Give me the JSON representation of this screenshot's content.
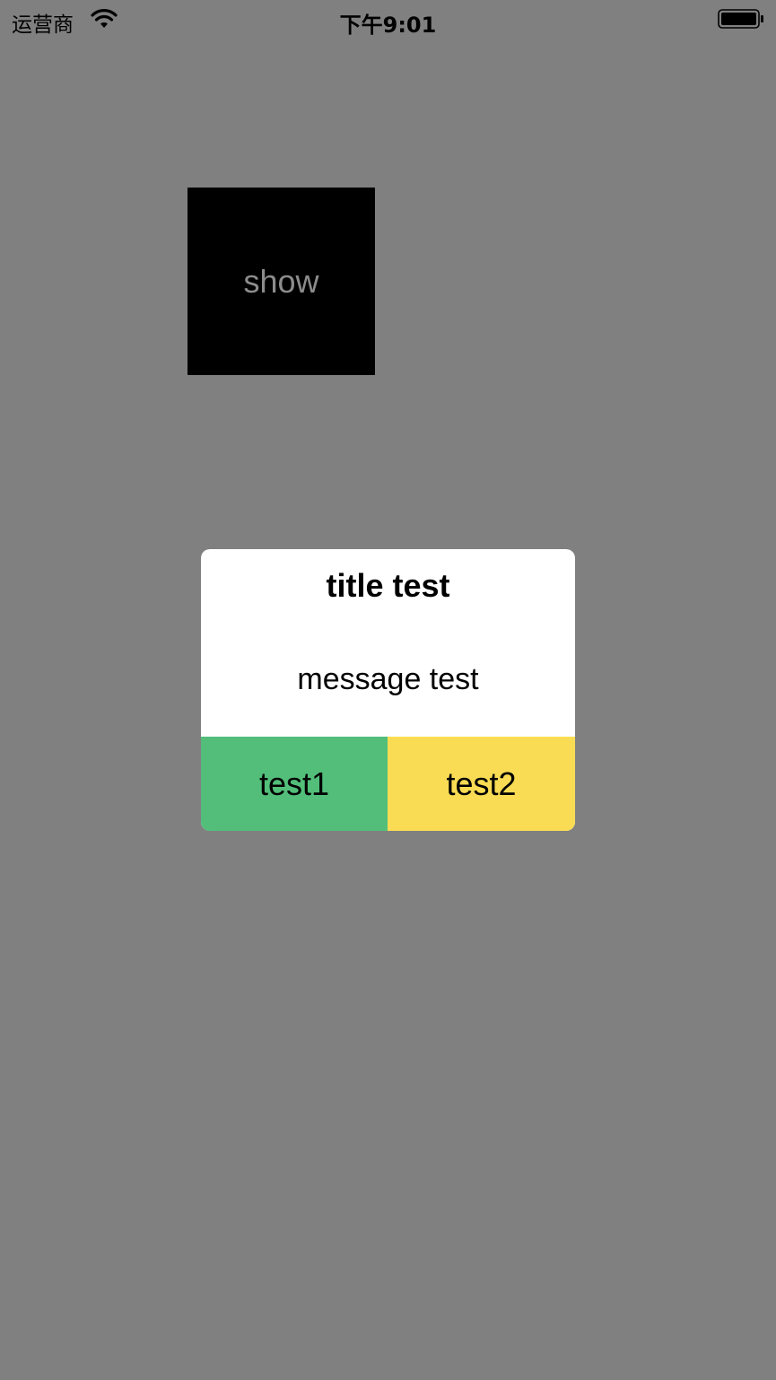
{
  "status_bar": {
    "carrier": "运营商",
    "time": "下午9:01",
    "wifi_icon": "wifi-icon",
    "battery_icon": "battery-icon"
  },
  "main": {
    "show_label": "show"
  },
  "alert": {
    "title": "title test",
    "message": "message test",
    "buttons": [
      {
        "label": "test1",
        "color": "#52be7a"
      },
      {
        "label": "test2",
        "color": "#f9dc53"
      }
    ]
  },
  "colors": {
    "background": "#808080",
    "show_button_bg": "#000000",
    "show_button_text": "#8c8c8c"
  }
}
